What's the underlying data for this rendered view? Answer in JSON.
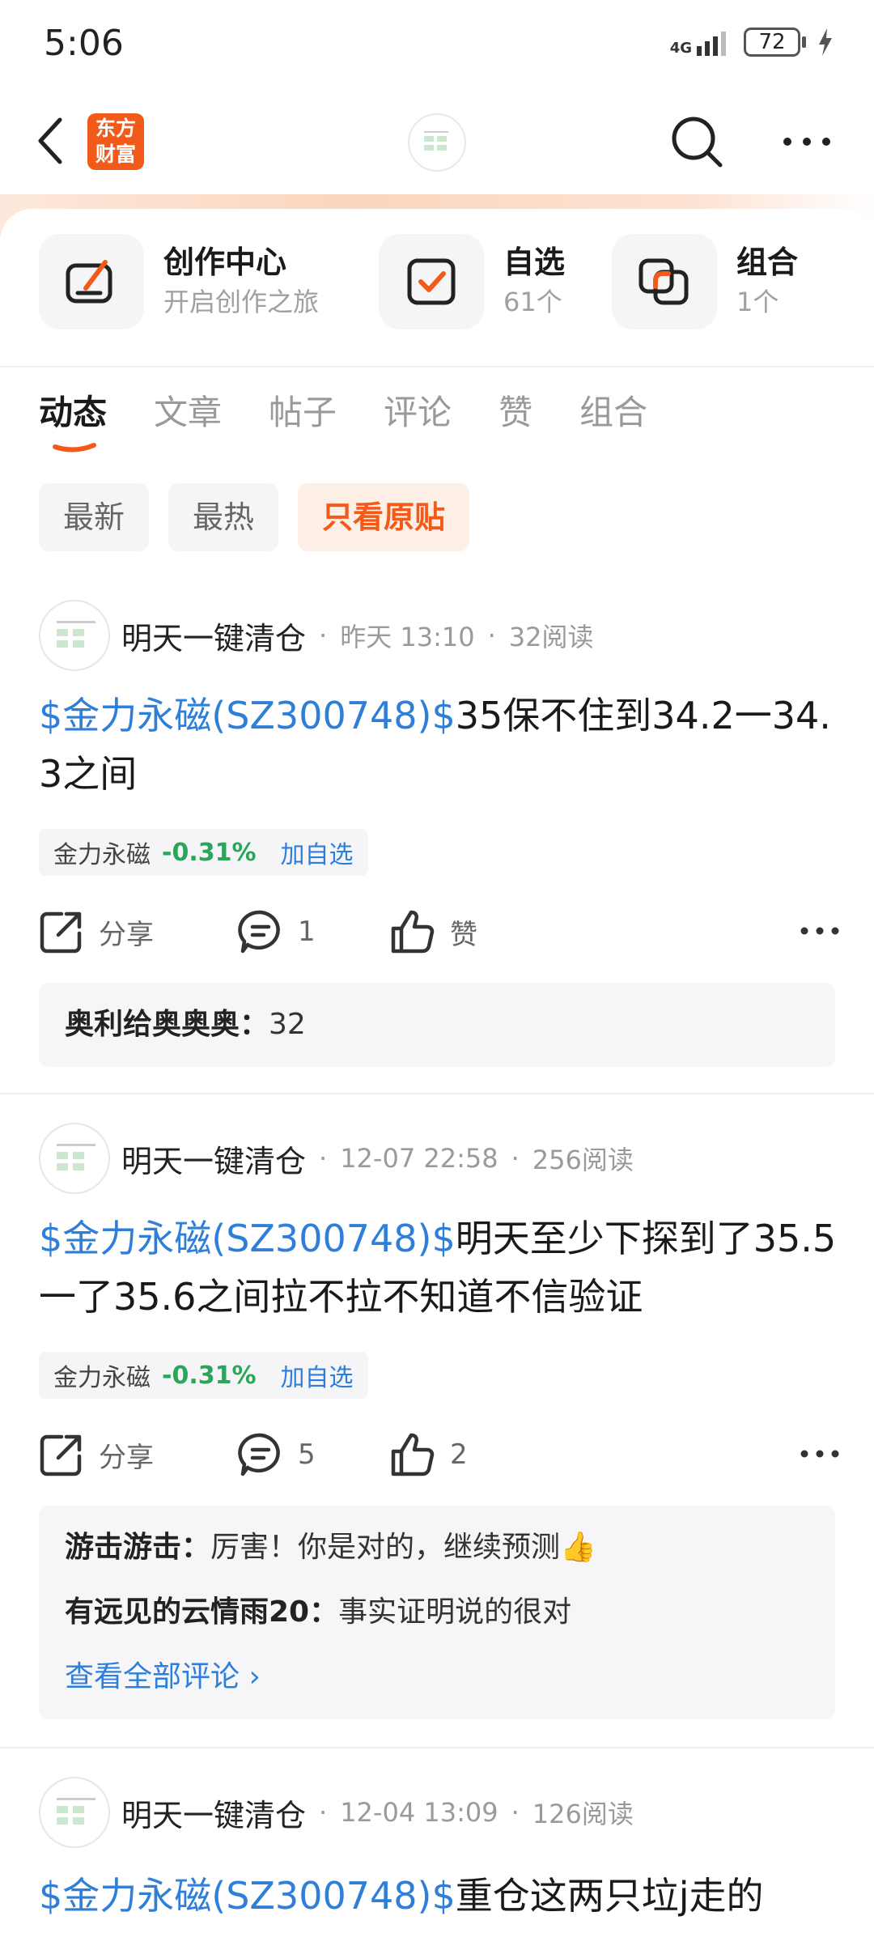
{
  "status_bar": {
    "time": "5:06",
    "network": "4G",
    "battery": "72"
  },
  "header": {
    "logo_line1": "东方",
    "logo_line2": "财富"
  },
  "quick_cards": [
    {
      "title": "创作中心",
      "subtitle": "开启创作之旅",
      "icon": "edit-icon"
    },
    {
      "title": "自选",
      "subtitle": "61个",
      "icon": "checkbox-icon"
    },
    {
      "title": "组合",
      "subtitle": "1个",
      "icon": "portfolio-icon"
    }
  ],
  "tabs": [
    "动态",
    "文章",
    "帖子",
    "评论",
    "赞",
    "组合"
  ],
  "filters": [
    "最新",
    "最热",
    "只看原贴"
  ],
  "posts": [
    {
      "author": "明天一键清仓",
      "time": "昨天 13:10",
      "reads": "32阅读",
      "stock_link": "$金力永磁(SZ300748)$",
      "text": "35保不住到34.2一34.3之间",
      "stock_name": "金力永磁",
      "stock_change": "-0.31%",
      "add_label": "加自选",
      "share_label": "分享",
      "comment_count": "1",
      "like_label": "赞",
      "comments": [
        {
          "user": "奥利给奥奥奥：",
          "text": "32"
        }
      ]
    },
    {
      "author": "明天一键清仓",
      "time": "12-07 22:58",
      "reads": "256阅读",
      "stock_link": "$金力永磁(SZ300748)$",
      "text": "明天至少下探到了35.5一了35.6之间拉不拉不知道不信验证",
      "stock_name": "金力永磁",
      "stock_change": "-0.31%",
      "add_label": "加自选",
      "share_label": "分享",
      "comment_count": "5",
      "like_label": "2",
      "comments": [
        {
          "user": "游击游击：",
          "text": "厉害！你是对的，继续预测👍"
        },
        {
          "user": "有远见的云情雨20：",
          "text": "事实证明说的很对"
        }
      ],
      "view_all": "查看全部评论 ›"
    },
    {
      "author": "明天一键清仓",
      "time": "12-04 13:09",
      "reads": "126阅读",
      "stock_link": "$金力永磁(SZ300748)$",
      "text": "重仓这两只垃j走的"
    }
  ],
  "meta_separator": "·",
  "colors": {
    "accent": "#f25a1a",
    "link": "#2f7fd9",
    "down": "#2aa55a"
  }
}
